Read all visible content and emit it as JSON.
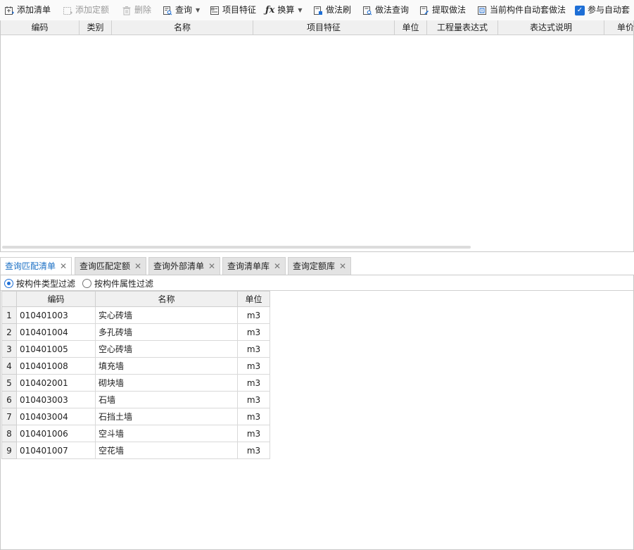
{
  "toolbar": {
    "add_list": "添加清单",
    "add_quota": "添加定额",
    "delete": "删除",
    "query": "查询",
    "item_features": "项目特征",
    "convert": "换算",
    "method_brush": "做法刷",
    "method_query": "做法查询",
    "extract_method": "提取做法",
    "auto_apply": "当前构件自动套做法",
    "participate_auto": "参与自动套"
  },
  "upper_grid": {
    "columns": [
      "编码",
      "类别",
      "名称",
      "项目特征",
      "单位",
      "工程量表达式",
      "表达式说明",
      "单价"
    ]
  },
  "tabs": [
    {
      "label": "查询匹配清单",
      "active": true
    },
    {
      "label": "查询匹配定额",
      "active": false
    },
    {
      "label": "查询外部清单",
      "active": false
    },
    {
      "label": "查询清单库",
      "active": false
    },
    {
      "label": "查询定额库",
      "active": false
    }
  ],
  "filter": {
    "by_type": "按构件类型过滤",
    "by_attr": "按构件属性过滤",
    "selected": "by_type"
  },
  "lower_grid": {
    "columns": [
      "编码",
      "名称",
      "单位"
    ],
    "rows": [
      {
        "num": "1",
        "code": "010401003",
        "name": "实心砖墙",
        "unit": "m3"
      },
      {
        "num": "2",
        "code": "010401004",
        "name": "多孔砖墙",
        "unit": "m3"
      },
      {
        "num": "3",
        "code": "010401005",
        "name": "空心砖墙",
        "unit": "m3"
      },
      {
        "num": "4",
        "code": "010401008",
        "name": "填充墙",
        "unit": "m3"
      },
      {
        "num": "5",
        "code": "010402001",
        "name": "砌块墙",
        "unit": "m3"
      },
      {
        "num": "6",
        "code": "010403003",
        "name": "石墙",
        "unit": "m3"
      },
      {
        "num": "7",
        "code": "010403004",
        "name": "石挡土墙",
        "unit": "m3"
      },
      {
        "num": "8",
        "code": "010401006",
        "name": "空斗墙",
        "unit": "m3"
      },
      {
        "num": "9",
        "code": "010401007",
        "name": "空花墙",
        "unit": "m3"
      }
    ]
  }
}
